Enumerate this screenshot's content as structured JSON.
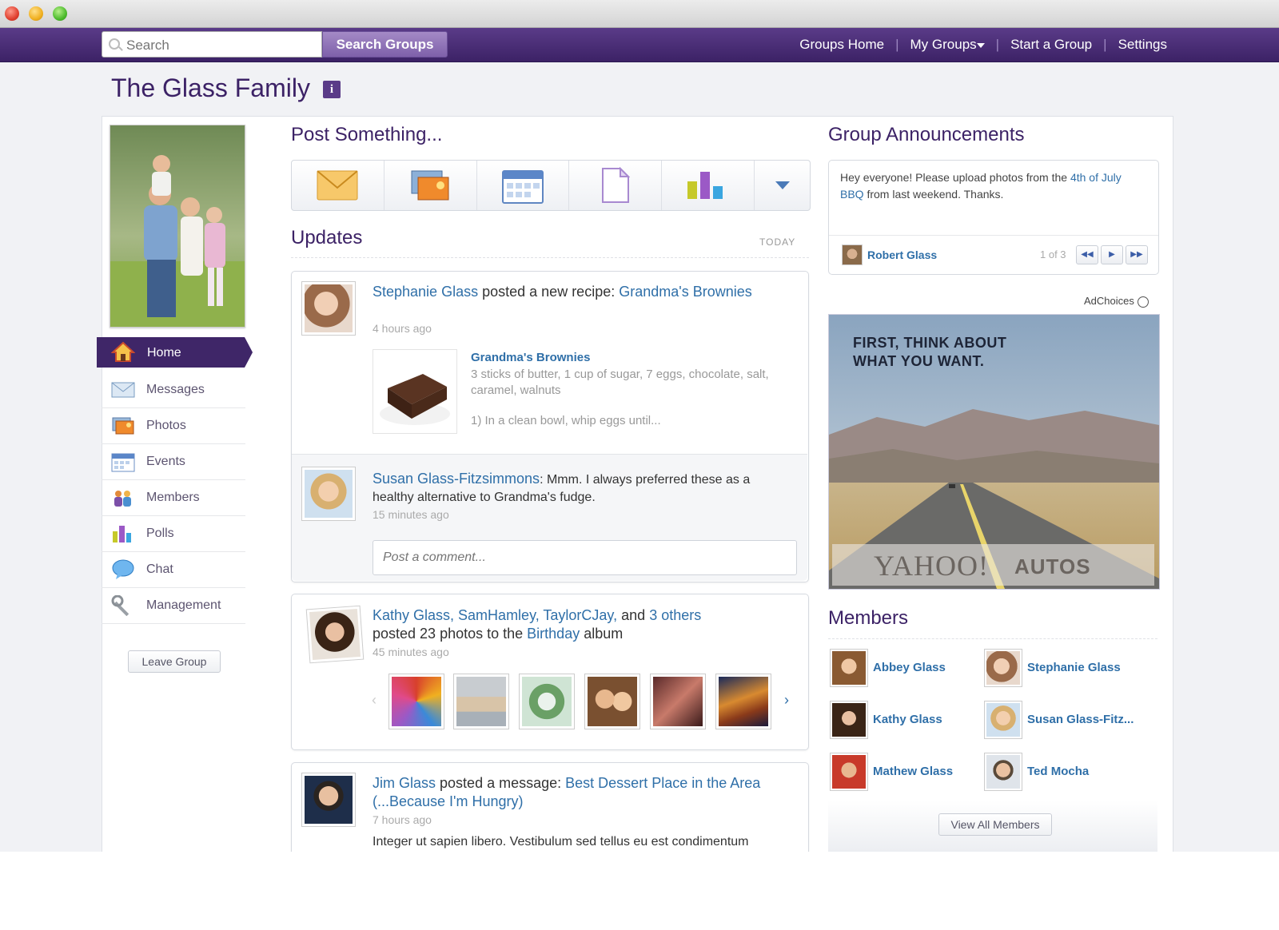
{
  "search": {
    "placeholder": "Search",
    "button": "Search Groups"
  },
  "topnav": {
    "home": "Groups Home",
    "my_groups": "My Groups",
    "start": "Start a Group",
    "settings": "Settings"
  },
  "group": {
    "title": "The Glass Family",
    "info": "i"
  },
  "sidebar": {
    "items": [
      {
        "label": "Home",
        "icon": "home-icon"
      },
      {
        "label": "Messages",
        "icon": "envelope-icon"
      },
      {
        "label": "Photos",
        "icon": "photos-icon"
      },
      {
        "label": "Events",
        "icon": "calendar-icon"
      },
      {
        "label": "Members",
        "icon": "members-icon"
      },
      {
        "label": "Polls",
        "icon": "poll-icon"
      },
      {
        "label": "Chat",
        "icon": "chat-bubble-icon"
      },
      {
        "label": "Management",
        "icon": "wrench-icon"
      }
    ],
    "leave": "Leave Group"
  },
  "post": {
    "heading": "Post Something..."
  },
  "updates": {
    "heading": "Updates",
    "today": "TODAY",
    "u1": {
      "author": "Stephanie Glass",
      "action": "posted a new recipe:",
      "link": "Grandma's Brownies",
      "time": "4 hours ago",
      "recipe_title": "Grandma's Brownies",
      "recipe_desc": "3 sticks of butter, 1 cup of sugar, 7 eggs, chocolate, salt, caramel, walnuts",
      "recipe_step": "1) In a clean bowl, whip eggs until...",
      "c_author": "Susan Glass-Fitzsimmons",
      "c_text": ": Mmm. I always preferred these as a healthy alternative to Grandma's fudge.",
      "c_time": "15 minutes ago",
      "comment_placeholder": "Post a comment..."
    },
    "u2": {
      "authors": "Kathy Glass, SamHamley, TaylorCJay,",
      "and": "and",
      "others": "3 others",
      "action": "posted 23 photos to the",
      "album": "Birthday",
      "album_suffix": "album",
      "time": "45 minutes ago"
    },
    "u3": {
      "author": "Jim Glass",
      "action": "posted a message:",
      "link": "Best Dessert Place in the Area (...Because I'm Hungry)",
      "time": "7 hours ago",
      "body": "Integer ut sapien libero. Vestibulum sed tellus eu est condimentum"
    }
  },
  "announcements": {
    "heading": "Group Announcements",
    "text_pre": "Hey everyone! Please upload photos from the",
    "text_link": "4th of July BBQ",
    "text_post": "from last weekend. Thanks.",
    "author": "Robert Glass",
    "pager": "1 of 3"
  },
  "ad": {
    "choices": "AdChoices",
    "headline1": "FIRST, THINK ABOUT",
    "headline2": "WHAT YOU WANT.",
    "brand": "YAHOO!",
    "brand2": "AUTOS"
  },
  "members": {
    "heading": "Members",
    "list": [
      "Abbey Glass",
      "Stephanie Glass",
      "Kathy Glass",
      "Susan Glass-Fitz...",
      "Mathew Glass",
      "Ted Mocha"
    ],
    "view_all": "View All Members"
  }
}
